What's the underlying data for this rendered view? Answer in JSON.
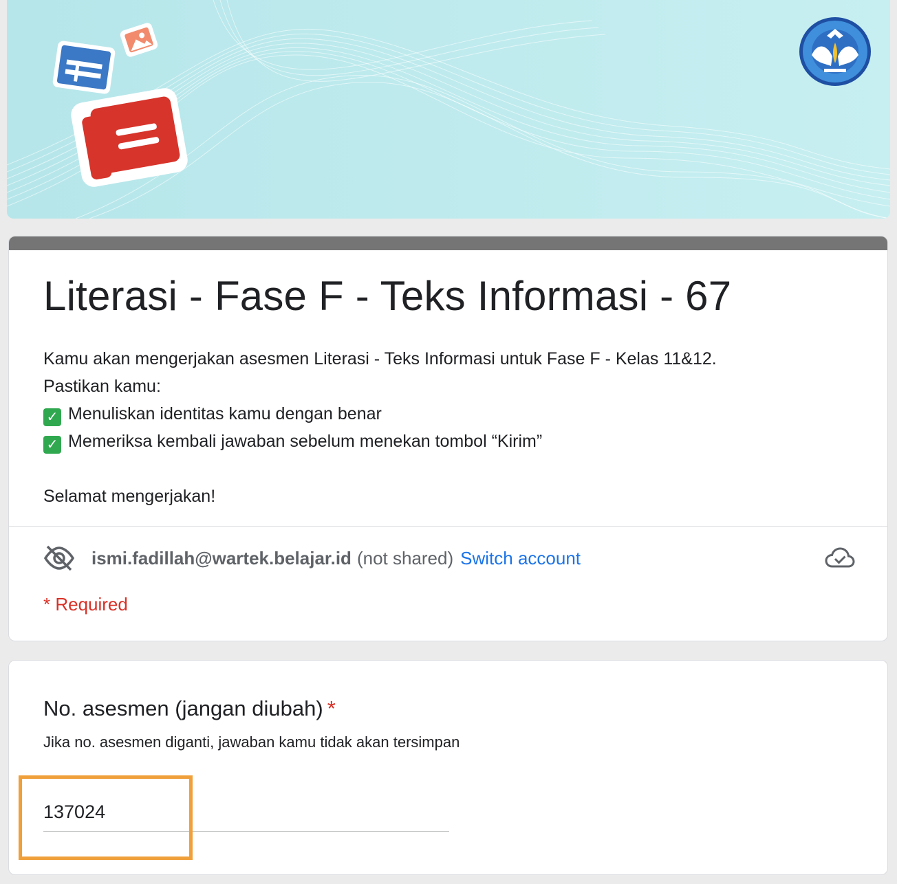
{
  "form": {
    "title": "Literasi - Fase F - Teks Informasi - 67",
    "description": {
      "line1": "Kamu akan mengerjakan asesmen Literasi - Teks Informasi untuk Fase F - Kelas 11&12.",
      "line2": "Pastikan kamu:",
      "checklist": [
        "Menuliskan identitas kamu dengan benar",
        "Memeriksa kembali jawaban sebelum menekan tombol “Kirim”"
      ],
      "closing": "Selamat mengerjakan!"
    },
    "account": {
      "email": "ismi.fadillah@wartek.belajar.id",
      "not_shared": "(not shared)",
      "switch_label": "Switch account"
    },
    "required_note": "* Required"
  },
  "question": {
    "title": "No. asesmen (jangan diubah)",
    "required_star": "*",
    "help": "Jika no. asesmen diganti, jawaban kamu tidak akan tersimpan",
    "value": "137024"
  },
  "colors": {
    "accent_bar": "#757575",
    "link": "#1a73e8",
    "required": "#d93025",
    "highlight": "#f0a03a"
  },
  "icons": [
    "visibility-off-icon",
    "cloud-done-icon",
    "kemendikbud-logo",
    "image-icon",
    "table-icon",
    "document-icon"
  ]
}
